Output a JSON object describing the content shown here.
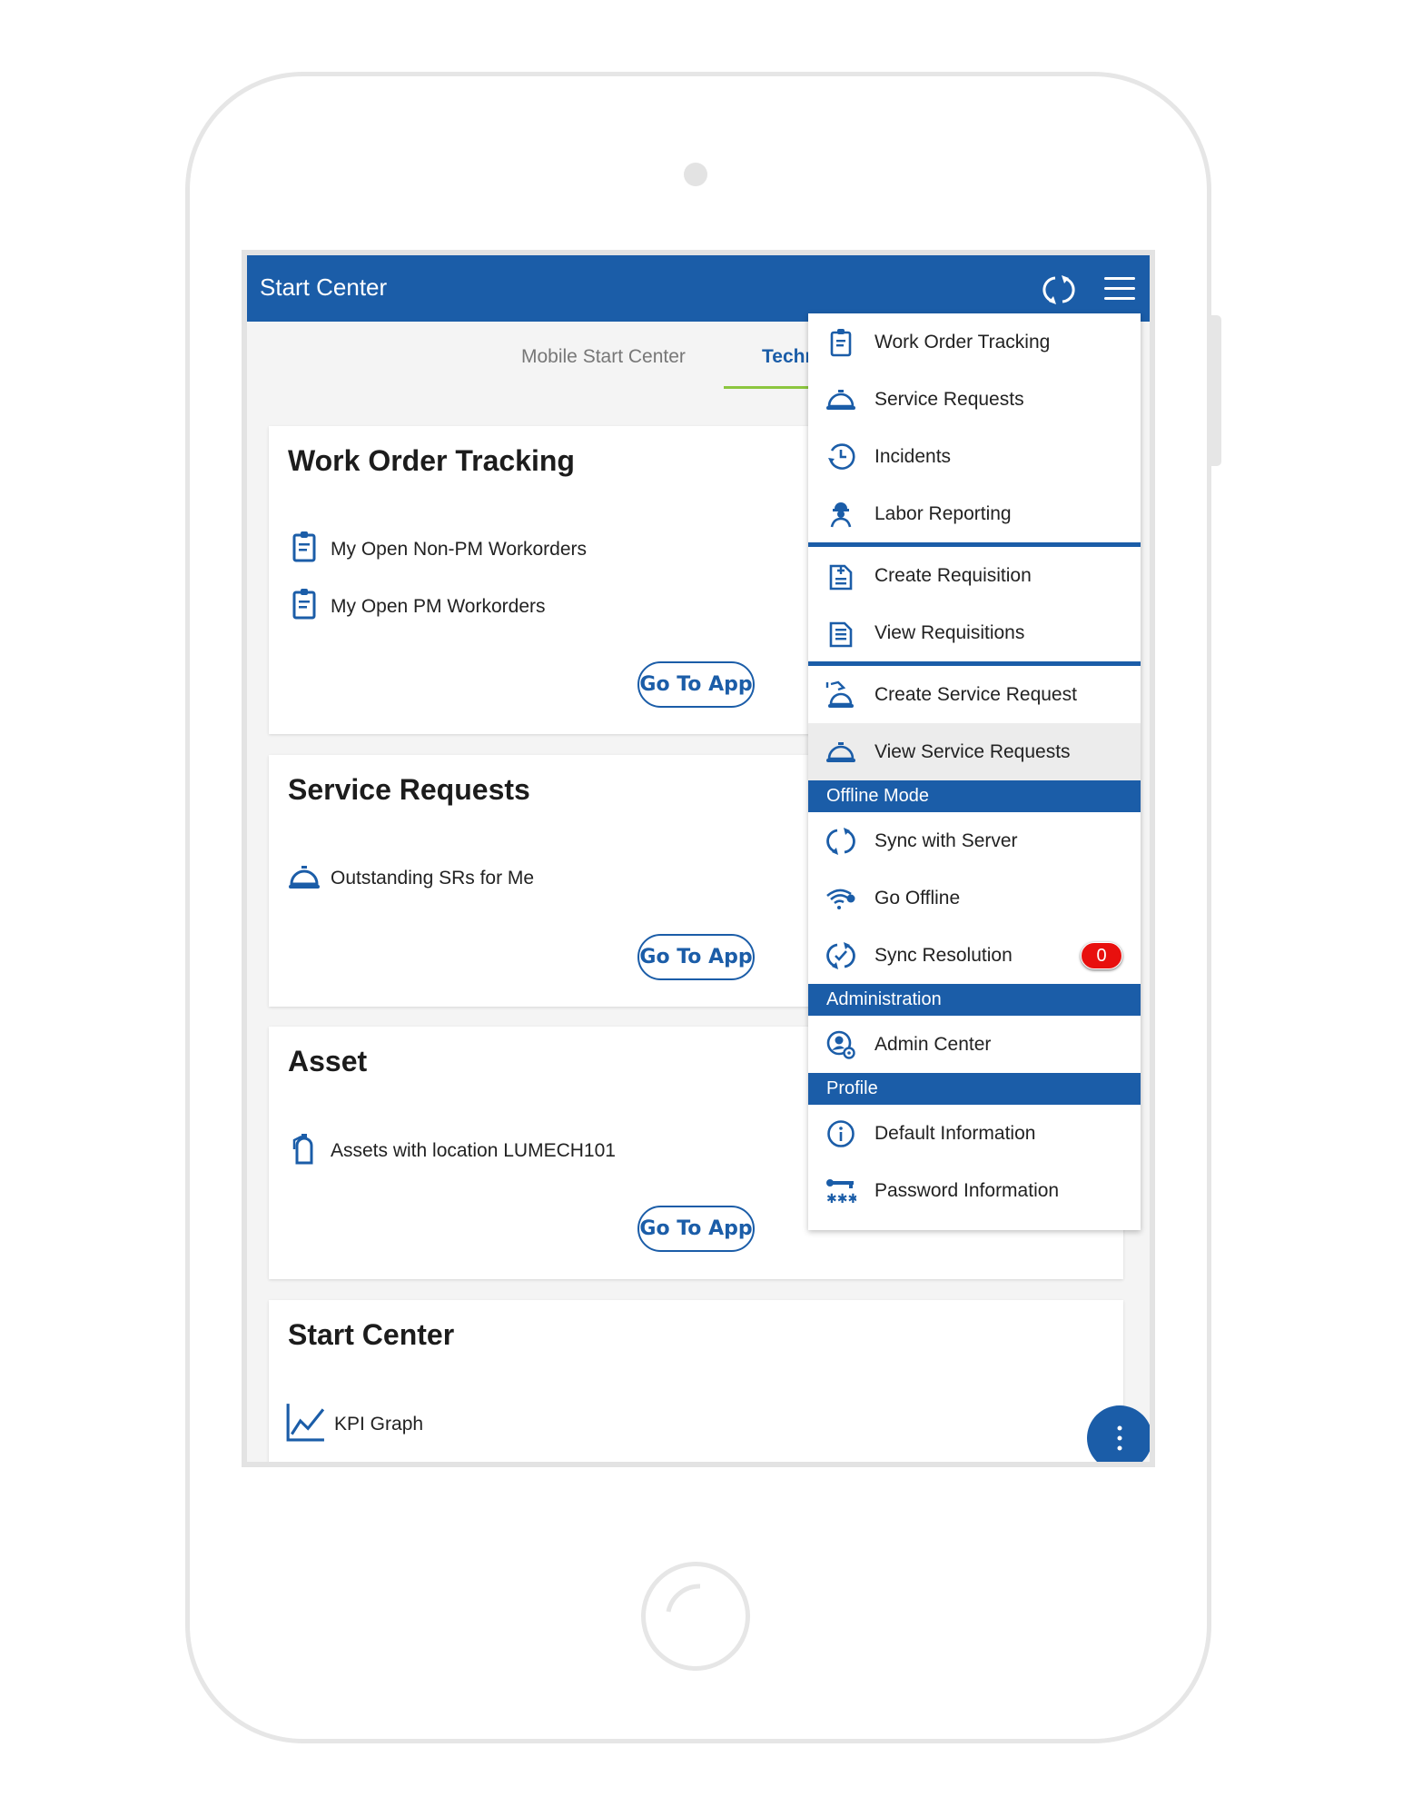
{
  "header": {
    "title": "Start Center",
    "sync_icon": "sync-icon",
    "menu_icon": "hamburger-icon"
  },
  "tabs": [
    {
      "label": "Mobile Start Center",
      "active": false
    },
    {
      "label": "Techn",
      "active": true
    }
  ],
  "colors": {
    "primary": "#1b5da8",
    "tab_underline": "#8cc63f",
    "badge": "#e8100e"
  },
  "cards": [
    {
      "title": "Work Order Tracking",
      "items": [
        {
          "label": "My Open Non-PM Workorders",
          "icon": "clipboard-icon"
        },
        {
          "label": "My Open PM Workorders",
          "icon": "clipboard-icon"
        }
      ],
      "button": "Go To App"
    },
    {
      "title": "Service Requests",
      "items": [
        {
          "label": "Outstanding SRs for Me",
          "icon": "service-bell-icon"
        }
      ],
      "button": "Go To App"
    },
    {
      "title": "Asset",
      "items": [
        {
          "label": "Assets with location LUMECH101",
          "icon": "fire-extinguisher-icon"
        }
      ],
      "button": "Go To App"
    },
    {
      "title": "Start Center",
      "items": [
        {
          "label": "KPI Graph",
          "icon": "line-chart-icon"
        }
      ]
    }
  ],
  "menu": [
    {
      "type": "item",
      "label": "Work Order Tracking",
      "icon": "clipboard"
    },
    {
      "type": "item",
      "label": "Service Requests",
      "icon": "bell"
    },
    {
      "type": "item",
      "label": "Incidents",
      "icon": "history"
    },
    {
      "type": "item",
      "label": "Labor Reporting",
      "icon": "worker"
    },
    {
      "type": "divider"
    },
    {
      "type": "item",
      "label": "Create Requisition",
      "icon": "doc-plus"
    },
    {
      "type": "item",
      "label": "View Requisitions",
      "icon": "doc-list"
    },
    {
      "type": "divider"
    },
    {
      "type": "item",
      "label": "Create Service Request",
      "icon": "bell-hand"
    },
    {
      "type": "item",
      "label": "View Service Requests",
      "icon": "bell",
      "highlighted": true
    },
    {
      "type": "header",
      "label": "Offline Mode"
    },
    {
      "type": "item",
      "label": "Sync with Server",
      "icon": "sync"
    },
    {
      "type": "item",
      "label": "Go Offline",
      "icon": "wifi"
    },
    {
      "type": "item",
      "label": "Sync Resolution",
      "icon": "sync-check",
      "badge": "0"
    },
    {
      "type": "header",
      "label": "Administration"
    },
    {
      "type": "item",
      "label": "Admin Center",
      "icon": "user-gear"
    },
    {
      "type": "header",
      "label": "Profile"
    },
    {
      "type": "item",
      "label": "Default Information",
      "icon": "info"
    },
    {
      "type": "item",
      "label": "Password Information",
      "icon": "password"
    }
  ],
  "fab": {
    "icon": "more-vertical-icon"
  }
}
